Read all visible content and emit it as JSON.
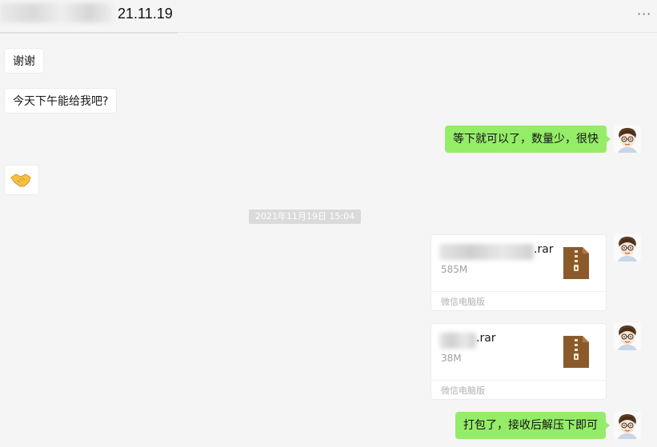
{
  "header": {
    "title": "21.11.19",
    "more_label": "···"
  },
  "messages_in": [
    "谢谢",
    "今天下午能给我吧?"
  ],
  "messages_out": [
    "等下就可以了，数量少，很快",
    "打包了，接收后解压下即可"
  ],
  "timestamp": "2021年11月19日 15:04",
  "files": [
    {
      "name_visible": ".rar",
      "size": "585M",
      "source": "微信电脑版"
    },
    {
      "name_visible": ".rar",
      "size": "38M",
      "source": "微信电脑版"
    }
  ],
  "icons": {
    "emoji": "handshake-icon",
    "file": "zip-file-icon",
    "avatar": "avatar-cartoon-man"
  },
  "colors": {
    "outgoing_bubble": "#95ec69",
    "background": "#f5f5f5",
    "file_icon": "#8a5a2b"
  }
}
